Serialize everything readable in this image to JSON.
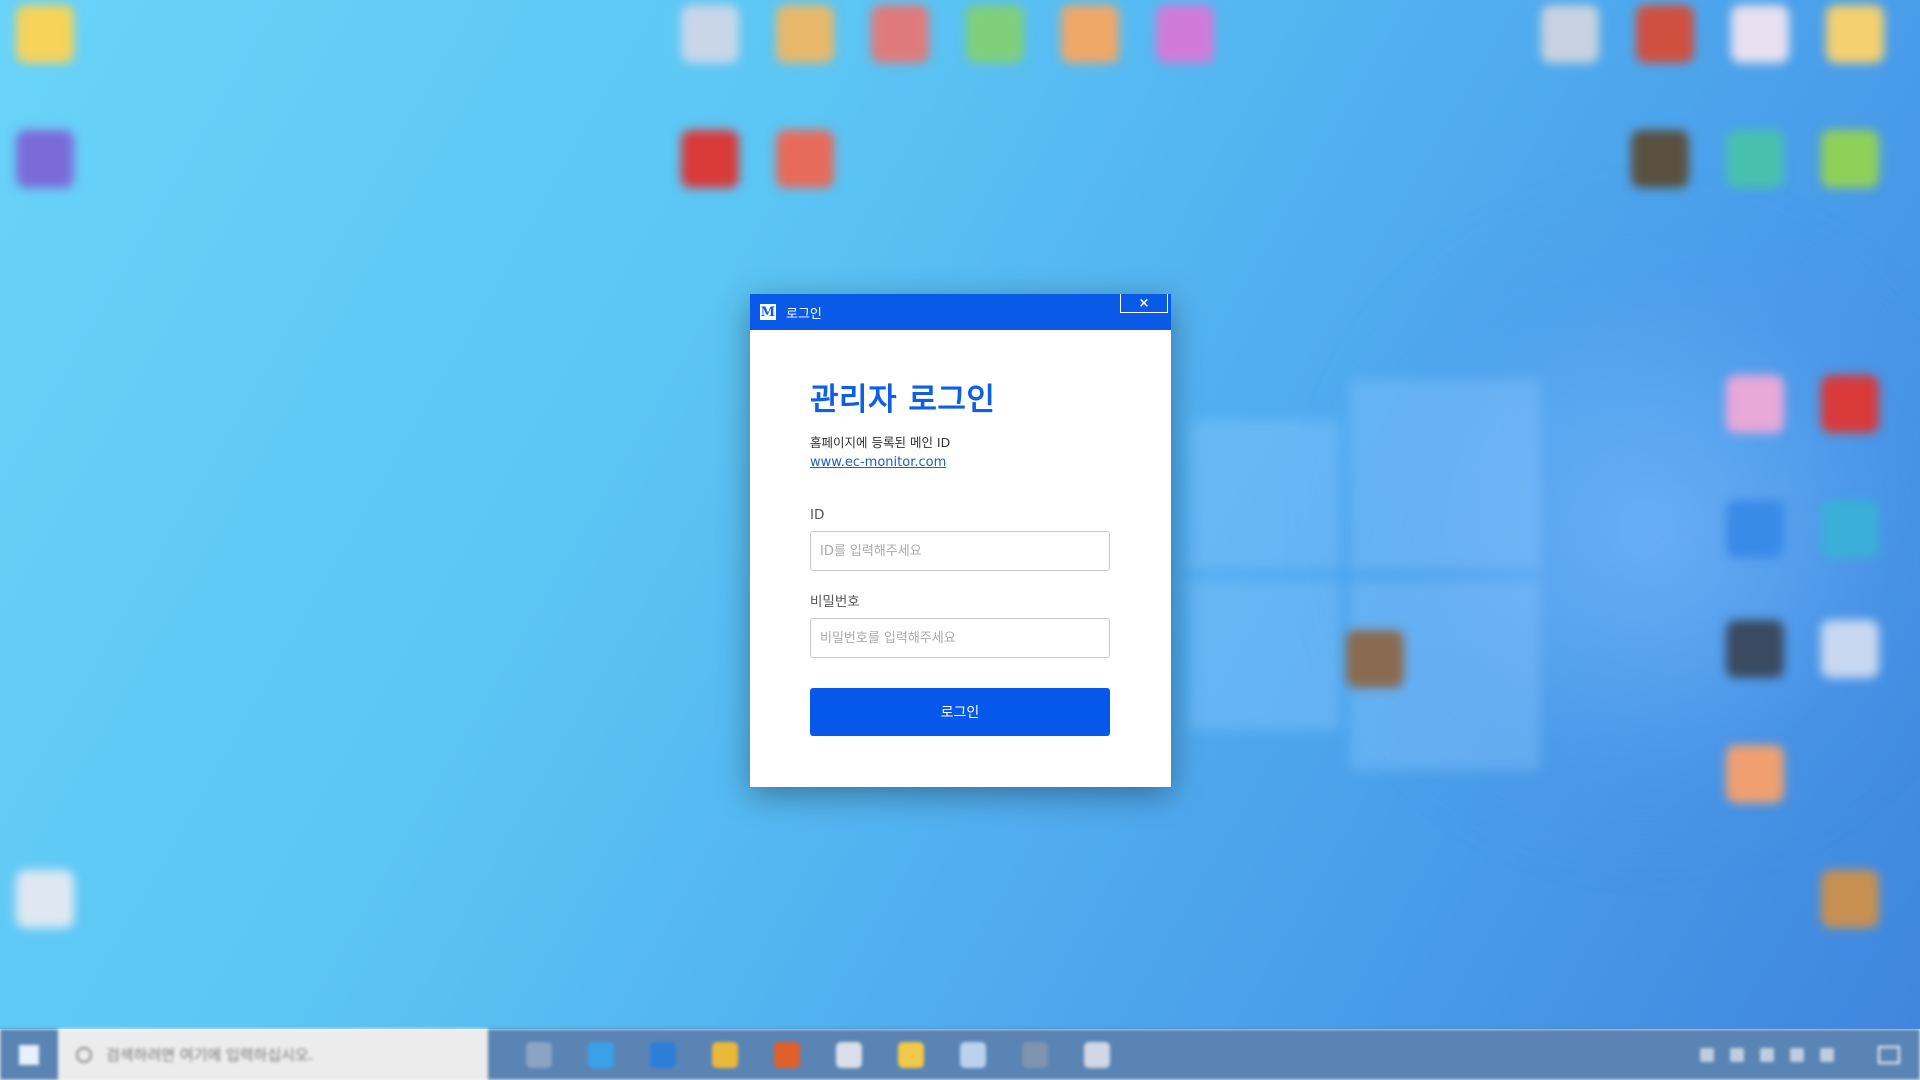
{
  "dialog": {
    "window_title": "로그인",
    "app_logo_letter": "M",
    "close_label": "×",
    "heading": "관리자 로그인",
    "description": "홈페이지에 등록된 메인 ID",
    "link_text": "www.ec-monitor.com",
    "id_label": "ID",
    "id_placeholder": "ID를 입력해주세요",
    "id_value": "",
    "password_label": "비밀번호",
    "password_placeholder": "비밀번호를 입력해주세요",
    "password_value": "",
    "login_button": "로그인",
    "accent_color": "#0a5ae8"
  },
  "taskbar": {
    "search_placeholder": "검색하려면 여기에 입력하십시오.",
    "apps": [
      {
        "icon": "task-view-icon",
        "color": "#8aa4c4"
      },
      {
        "icon": "internet-explorer-icon",
        "color": "#3aa0e8"
      },
      {
        "icon": "edge-icon",
        "color": "#2b7fd8"
      },
      {
        "icon": "chrome-icon",
        "color": "#e9b93a"
      },
      {
        "icon": "firefox-icon",
        "color": "#e0602c"
      },
      {
        "icon": "photos-icon",
        "color": "#d9dfe8"
      },
      {
        "icon": "file-explorer-icon",
        "color": "#f0c84a"
      },
      {
        "icon": "notepad-icon",
        "color": "#b9d3ee"
      },
      {
        "icon": "app-icon",
        "color": "#7f94ad"
      },
      {
        "icon": "steam-icon",
        "color": "#cfd8e4"
      }
    ]
  },
  "desktop_icons": [
    {
      "icon": "folder-icon",
      "color": "#f6d35a"
    },
    {
      "icon": "visual-studio-icon",
      "color": "#7b6ad8"
    },
    {
      "icon": "recycle-bin-icon",
      "color": "#dfe8f2"
    },
    {
      "icon": "app-icon",
      "color": "#c9d6ea"
    },
    {
      "icon": "app-icon",
      "color": "#e8b86a"
    },
    {
      "icon": "app-icon",
      "color": "#e07a7a"
    },
    {
      "icon": "app-icon",
      "color": "#7fcf7a"
    },
    {
      "icon": "app-icon",
      "color": "#f0a868"
    },
    {
      "icon": "app-icon",
      "color": "#d07ad8"
    },
    {
      "icon": "acrobat-icon",
      "color": "#d83a3a"
    },
    {
      "icon": "app-icon",
      "color": "#e86a5a"
    },
    {
      "icon": "app-icon",
      "color": "#c8d2e0"
    },
    {
      "icon": "app-icon",
      "color": "#d05040"
    },
    {
      "icon": "app-icon",
      "color": "#e8e0f0"
    },
    {
      "icon": "app-icon",
      "color": "#f4d070"
    },
    {
      "icon": "app-icon",
      "color": "#5a5040"
    },
    {
      "icon": "app-icon",
      "color": "#48c0b0"
    },
    {
      "icon": "app-icon",
      "color": "#8fd05a"
    },
    {
      "icon": "app-icon",
      "color": "#e8a8d8"
    },
    {
      "icon": "app-icon",
      "color": "#d83a3a"
    },
    {
      "icon": "app-icon",
      "color": "#3a8ae8"
    },
    {
      "icon": "app-icon",
      "color": "#3ab0d8"
    },
    {
      "icon": "steam-icon",
      "color": "#3a4a60"
    },
    {
      "icon": "app-icon",
      "color": "#c8d8f0"
    },
    {
      "icon": "app-icon",
      "color": "#f0a070"
    },
    {
      "icon": "app-icon",
      "color": "#c89050"
    },
    {
      "icon": "app-icon",
      "color": "#8a6a50"
    }
  ]
}
